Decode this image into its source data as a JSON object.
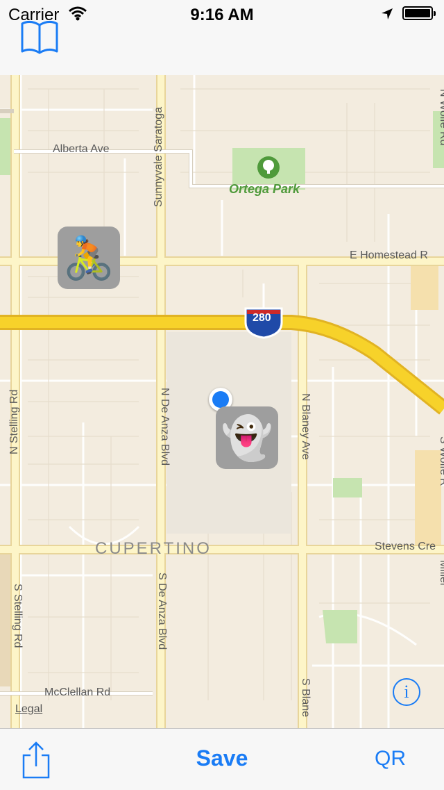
{
  "status": {
    "carrier": "Carrier",
    "time": "9:16 AM"
  },
  "nav": {
    "book_icon": "book-icon"
  },
  "map": {
    "streets": {
      "alberta": "Alberta Ave",
      "saratoga": "Sunnyvale Saratoga",
      "homestead": "E Homestead R",
      "stelling_n": "N Stelling Rd",
      "de_anza_n": "N De Anza Blvd",
      "blaney_n": "N Blaney Ave",
      "wolfe_n": "N Wolfe Rd",
      "wolfe_s": "S Wolfe R",
      "stevens": "Stevens Cre",
      "stelling_s": "S Stelling Rd",
      "de_anza_s": "S De Anza Blvd",
      "blaney_s": "S Blane",
      "mcclellan": "McClellan Rd",
      "miller": "Miller"
    },
    "highway": "280",
    "park": "Ortega Park",
    "city": "CUPERTINO",
    "legal": "Legal",
    "info": "i",
    "pins": [
      {
        "emoji": "🚴"
      },
      {
        "emoji": "👻"
      }
    ]
  },
  "toolbar": {
    "save": "Save",
    "qr": "QR"
  },
  "colors": {
    "accent": "#1a7cf5",
    "highway": "#f7d22a",
    "major_road": "#fdf5c8",
    "park": "#c6e4b0"
  }
}
